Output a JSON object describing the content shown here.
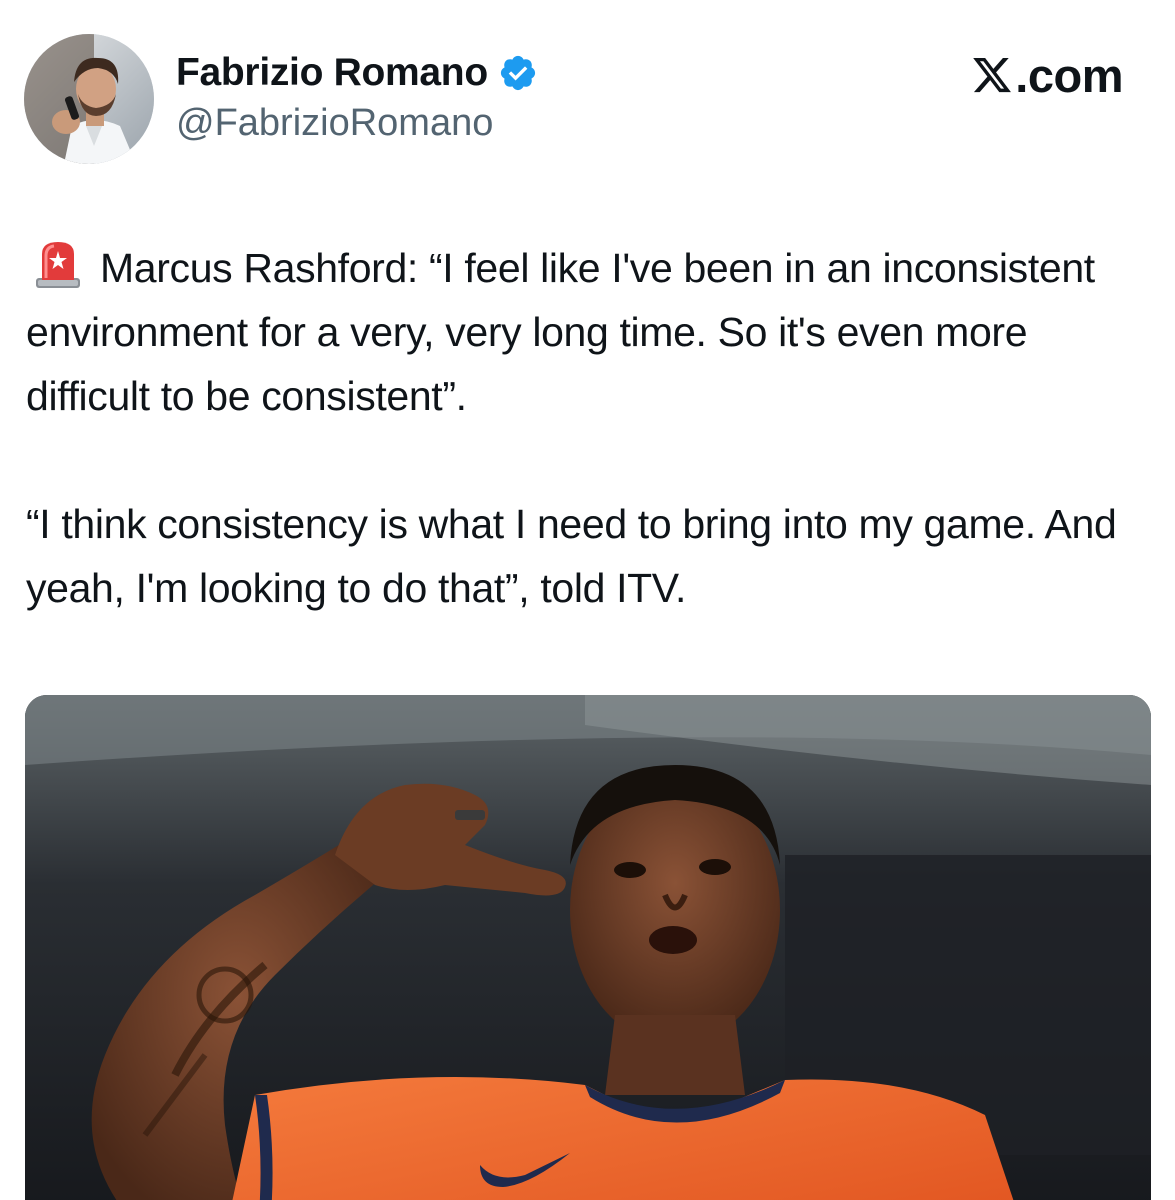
{
  "author": {
    "display_name": "Fabrizio Romano",
    "handle": "@FabrizioRomano",
    "verified": true,
    "avatar_icon": "avatar-photo"
  },
  "brand": {
    "text": ".com",
    "logo_icon": "x-logo-icon"
  },
  "tweet": {
    "emoji_icon": "police-siren-icon",
    "paragraph_1": "Marcus Rashford: “I feel like I've been in an inconsistent environment for a very, very long time. So it's even more difficult to be consistent”.",
    "paragraph_2": "“I think consistency is what I need to bring into my game. And yeah, I'm looking to do that”, told ITV."
  },
  "media": {
    "type": "photo",
    "icon": "player-celebration-photo"
  },
  "colors": {
    "text_primary": "#0f1419",
    "text_secondary": "#536471",
    "verified_blue": "#1d9bf0",
    "kit_orange": "#f26b2b",
    "kit_navy": "#1f2a4d"
  }
}
